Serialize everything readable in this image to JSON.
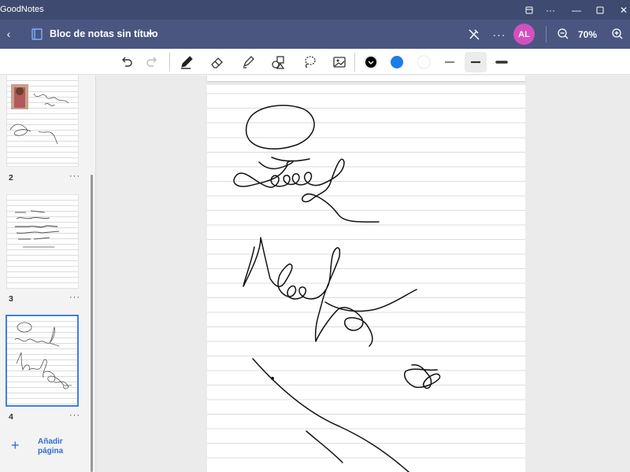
{
  "titlebar": {
    "app_name": "GoodNotes",
    "buttons": [
      "pin-icon",
      "more-icon",
      "minimize-icon",
      "maximize-icon",
      "close-icon"
    ]
  },
  "header": {
    "document_title": "Bloc de notas sin título",
    "avatar_initials": "AL",
    "zoom_level": "70%"
  },
  "toolbar": {
    "tools": [
      "undo-icon",
      "redo-icon",
      "pen-icon",
      "eraser-icon",
      "highlighter-icon",
      "shapes-icon",
      "lasso-icon",
      "image-icon"
    ],
    "colors": {
      "selected": "#000000",
      "blue": "#1a7de8",
      "white": "#ffffff"
    },
    "stroke_widths": [
      "thin",
      "medium",
      "thick"
    ],
    "selected_stroke": "medium"
  },
  "sidebar": {
    "pages": [
      {
        "number": "2"
      },
      {
        "number": "3"
      },
      {
        "number": "4",
        "selected": true
      }
    ],
    "add_page_label": "Añadir página"
  },
  "colors": {
    "titlebar_bg": "#3f4a70",
    "header_bg": "#4a5680",
    "accent": "#2b6fd6",
    "avatar_bg": "#d44fbf",
    "selection_border": "#3f7fe0"
  }
}
